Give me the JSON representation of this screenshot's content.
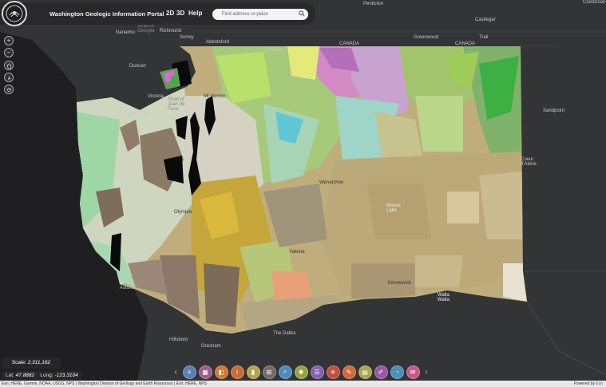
{
  "header": {
    "title": "Washington Geologic Information Portal",
    "btn_2d": "2D",
    "btn_3d": "3D",
    "btn_help": "Help",
    "search_placeholder": "Find address or place"
  },
  "map_labels": {
    "penticton": "Penticton",
    "castlegar": "Castlegar",
    "cranbrook": "Cranbrook",
    "trail": "Trail",
    "greenwood": "Greenwood",
    "nanaimo": "Nanaimo",
    "vancouver": "Vancouver",
    "richmond": "Richmond",
    "surrey": "Surrey",
    "abbotsford": "Abbotsford",
    "canada_west": "CANADA",
    "canada_mid": "CANADA",
    "canada_east": "CANADA",
    "duncan": "Duncan",
    "victoria": "Victoria",
    "united_states": "UNITED STATES",
    "sandpoint": "Sandpoint",
    "coeur_dalene": "Coeur\nd'Alene",
    "mount_vernon": "Mt Vernon",
    "olympia": "Olympia",
    "astoria": "Astoria",
    "hillsboro": "Hillsboro",
    "gresham": "Gresham",
    "the_dalles": "The Dalles",
    "walla_walla": "Walla\nWalla",
    "kennewick": "Kennewick",
    "moses_lake": "Moses\nLake",
    "yakima": "Yakima",
    "wenatchee": "Wenatchee",
    "strait_georgia": "Strait of\nGeorgia",
    "strait_juan": "Strait of\nJuan de\nFuca"
  },
  "scale": {
    "label": "Scale:",
    "value": "2,311,162"
  },
  "coords": {
    "lat_label": "Lat:",
    "lat_value": "47.8882",
    "long_label": "Long:",
    "long_value": "-123.3104"
  },
  "toolbar": {
    "left_arrow": "‹",
    "right_arrow": "›",
    "buttons": [
      {
        "name": "layers-button",
        "icon": "layers-icon",
        "color": "#5b7fb0"
      },
      {
        "name": "basemap-button",
        "icon": "basemap-icon",
        "color": "#a25a8f"
      },
      {
        "name": "legend-button",
        "icon": "legend-icon",
        "color": "#d4772b"
      },
      {
        "name": "info-button",
        "icon": "info-icon",
        "color": "#c96b35"
      },
      {
        "name": "bookmark-button",
        "icon": "bookmark-icon",
        "color": "#b6a24a"
      },
      {
        "name": "grid-button",
        "icon": "grid-icon",
        "color": "#6c6c6c"
      },
      {
        "name": "query-button",
        "icon": "query-icon",
        "color": "#4d8bbf"
      },
      {
        "name": "identify-button",
        "icon": "identify-icon",
        "color": "#9aa23c"
      },
      {
        "name": "list-button",
        "icon": "list-icon",
        "color": "#8a5fb0"
      },
      {
        "name": "measure-button",
        "icon": "measure-icon",
        "color": "#c2503d"
      },
      {
        "name": "draw-button",
        "icon": "draw-icon",
        "color": "#d46a3a"
      },
      {
        "name": "print-button",
        "icon": "print-icon",
        "color": "#a7a64a"
      },
      {
        "name": "edit-button",
        "icon": "pencil-icon",
        "color": "#9b56a8"
      },
      {
        "name": "share-button",
        "icon": "share-icon",
        "color": "#4a90b8"
      },
      {
        "name": "email-button",
        "icon": "email-icon",
        "color": "#c65a86"
      }
    ]
  },
  "attribution": {
    "text": "Esri, HERE, Garmin, NOAA, USGS, NPS | Washington Division of Geology and Earth Resources | Esri, HERE, NPS",
    "powered_by": "Powered by",
    "esri": "Esri"
  }
}
